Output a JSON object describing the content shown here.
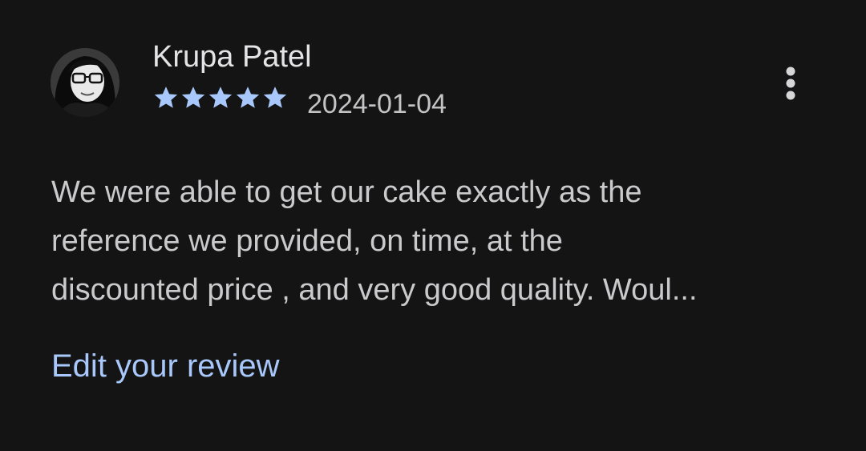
{
  "review": {
    "author_name": "Krupa Patel",
    "rating": 5,
    "max_rating": 5,
    "date": "2024-01-04",
    "text_lines": [
      "We were able to get our cake exactly as the",
      "reference we provided, on time, at the",
      "discounted price , and very good quality. Woul..."
    ],
    "edit_label": "Edit your review",
    "menu_icon": "more-vert-icon",
    "star_icon": "star-icon"
  },
  "colors": {
    "background": "#141414",
    "star": "#a8c7fa",
    "link": "#a8c7fa",
    "name": "#e4e4e6",
    "body_text": "#cacacc"
  }
}
